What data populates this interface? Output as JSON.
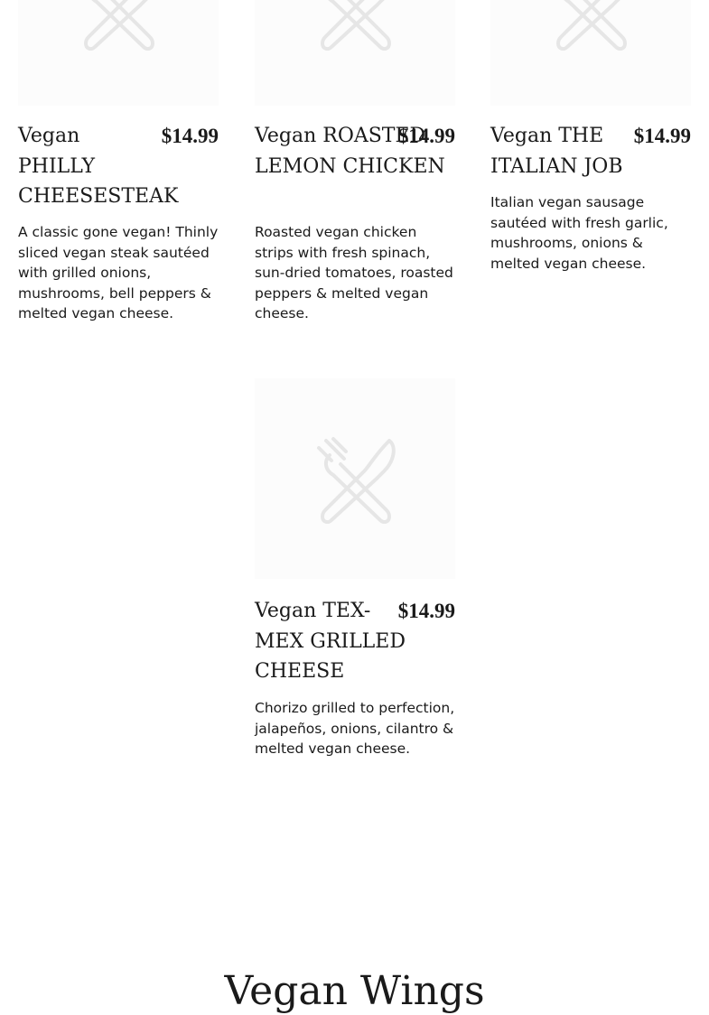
{
  "menu_items": [
    {
      "name": "Vegan PHILLY CHEESESTEAK",
      "price": "$14.99",
      "description": "A classic gone vegan! Thinly sliced vegan steak sautéed with grilled onions, mushrooms, bell peppers & melted vegan cheese.",
      "image_icon": "fork-knife-icon"
    },
    {
      "name": "Vegan ROASTED LEMON CHICKEN",
      "price": "$14.99",
      "description": "Roasted vegan chicken strips with fresh spinach, sun-dried tomatoes, roasted peppers & melted vegan cheese.",
      "image_icon": "fork-knife-icon"
    },
    {
      "name": "Vegan THE ITALIAN JOB",
      "price": "$14.99",
      "description": "Italian vegan sausage sautéed with fresh garlic, mushrooms, onions & melted vegan cheese.",
      "image_icon": "fork-knife-icon"
    },
    {
      "name": "Vegan TEX-MEX GRILLED CHEESE",
      "price": "$14.99",
      "description": "Chorizo grilled to perfection, jalapeños, onions, cilantro & melted vegan cheese.",
      "image_icon": "fork-knife-icon"
    }
  ],
  "next_section": {
    "title": "Vegan Wings"
  },
  "colors": {
    "text": "#1a1a1a",
    "placeholder_bg": "#fcfcfc",
    "placeholder_icon": "#e6e6e6"
  }
}
